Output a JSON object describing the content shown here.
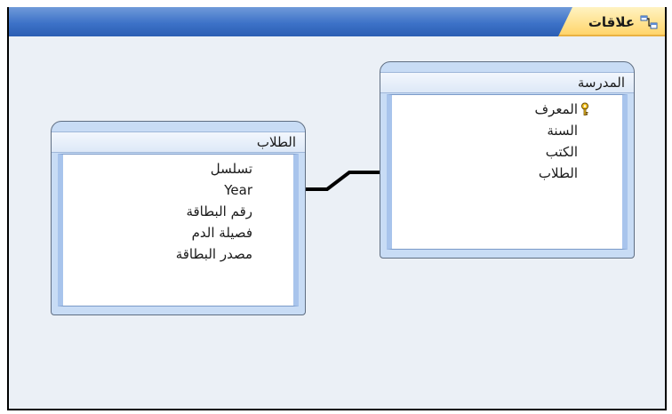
{
  "header": {
    "tab_label": "علاقات",
    "tab_icon": "relationships-icon"
  },
  "tables": {
    "students": {
      "title": "الطلاب",
      "fields": [
        "تسلسل",
        "Year",
        "رقم البطاقة",
        "فصيلة الدم",
        "مصدر البطاقة"
      ]
    },
    "school": {
      "title": "المدرسة",
      "fields": [
        "المعرف",
        "السنة",
        "الكتب",
        "الطلاب"
      ],
      "primary_key": "المعرف"
    }
  },
  "colors": {
    "title_bar": "#3d72c8",
    "tab": "#ffd56b",
    "canvas": "#ebf0f6",
    "table_frame": "#c8dcf5"
  }
}
